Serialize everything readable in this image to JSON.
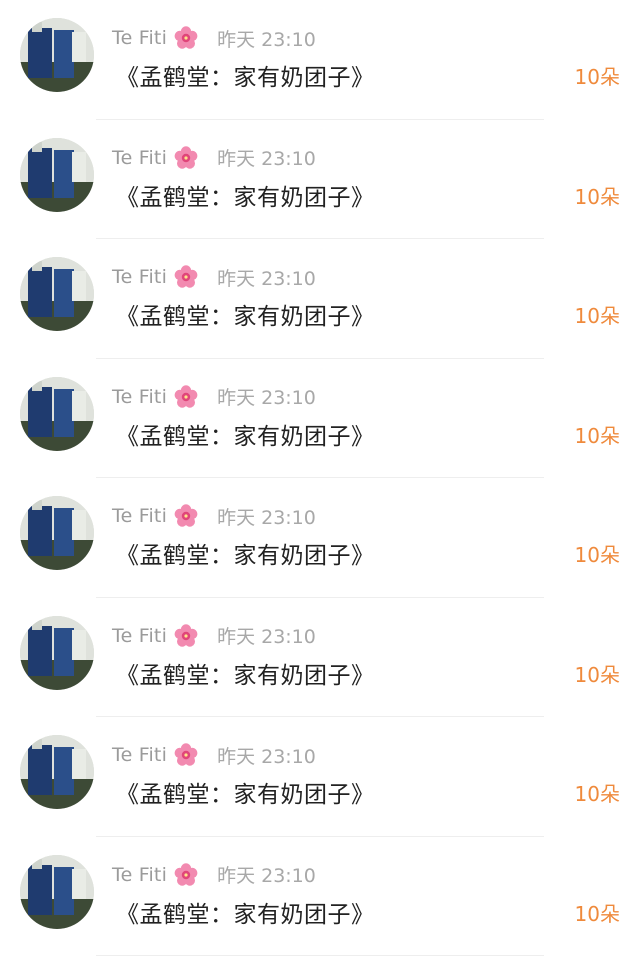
{
  "gift_list": [
    {
      "username": "Te Fiti",
      "badge_icon": "pink-flower-icon",
      "time": "昨天 23:10",
      "gift": "《孟鹤堂：家有奶团子》",
      "count": "10朵"
    },
    {
      "username": "Te Fiti",
      "badge_icon": "pink-flower-icon",
      "time": "昨天 23:10",
      "gift": "《孟鹤堂：家有奶团子》",
      "count": "10朵"
    },
    {
      "username": "Te Fiti",
      "badge_icon": "pink-flower-icon",
      "time": "昨天 23:10",
      "gift": "《孟鹤堂：家有奶团子》",
      "count": "10朵"
    },
    {
      "username": "Te Fiti",
      "badge_icon": "pink-flower-icon",
      "time": "昨天 23:10",
      "gift": "《孟鹤堂：家有奶团子》",
      "count": "10朵"
    },
    {
      "username": "Te Fiti",
      "badge_icon": "pink-flower-icon",
      "time": "昨天 23:10",
      "gift": "《孟鹤堂：家有奶团子》",
      "count": "10朵"
    },
    {
      "username": "Te Fiti",
      "badge_icon": "pink-flower-icon",
      "time": "昨天 23:10",
      "gift": "《孟鹤堂：家有奶团子》",
      "count": "10朵"
    },
    {
      "username": "Te Fiti",
      "badge_icon": "pink-flower-icon",
      "time": "昨天 23:10",
      "gift": "《孟鹤堂：家有奶团子》",
      "count": "10朵"
    },
    {
      "username": "Te Fiti",
      "badge_icon": "pink-flower-icon",
      "time": "昨天 23:10",
      "gift": "《孟鹤堂：家有奶团子》",
      "count": "10朵"
    }
  ],
  "colors": {
    "username": "#9b9b9b",
    "time": "#a8a8a8",
    "gift_text": "#222222",
    "count_accent": "#ef8a3c",
    "divider": "#eeeeee",
    "flower": "#f06292"
  }
}
